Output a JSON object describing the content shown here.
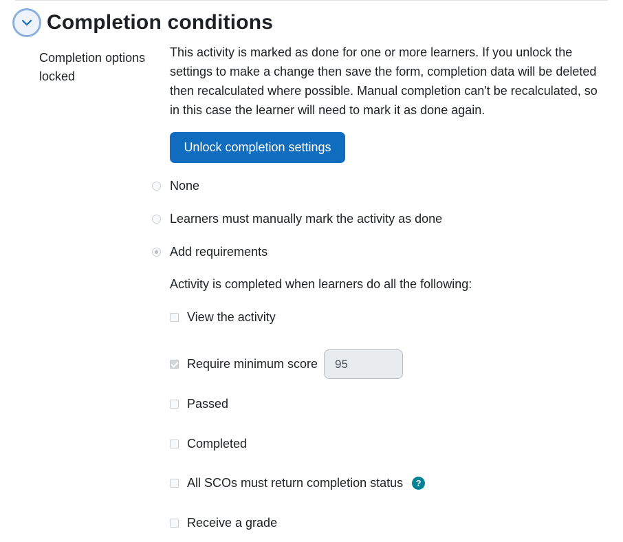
{
  "section": {
    "title": "Completion conditions",
    "toggle_icon": "chevron-down-icon"
  },
  "locked": {
    "label": "Completion options locked",
    "explanation": "This activity is marked as done for one or more learners. If you unlock the settings to make a change then save the form, completion data will be deleted then recalculated where possible. Manual completion can't be recalculated, so in this case the learner will need to mark it as done again.",
    "unlock_button": "Unlock completion settings"
  },
  "completion_options": [
    {
      "label": "None",
      "checked": false
    },
    {
      "label": "Learners must manually mark the activity as done",
      "checked": false
    },
    {
      "label": "Add requirements",
      "checked": true
    }
  ],
  "requirements": {
    "intro": "Activity is completed when learners do all the following:",
    "items": [
      {
        "label": "View the activity",
        "checked": false
      },
      {
        "label": "Require minimum score",
        "checked": true,
        "value": "95"
      },
      {
        "label": "Passed",
        "checked": false
      },
      {
        "label": "Completed",
        "checked": false
      },
      {
        "label": "All SCOs must return completion status",
        "checked": false,
        "help_icon": "help-icon",
        "help_glyph": "?"
      },
      {
        "label": "Receive a grade",
        "checked": false
      }
    ]
  },
  "colors": {
    "primary_button": "#0f6cbf",
    "help_icon": "#008196",
    "text": "#1d2125"
  }
}
